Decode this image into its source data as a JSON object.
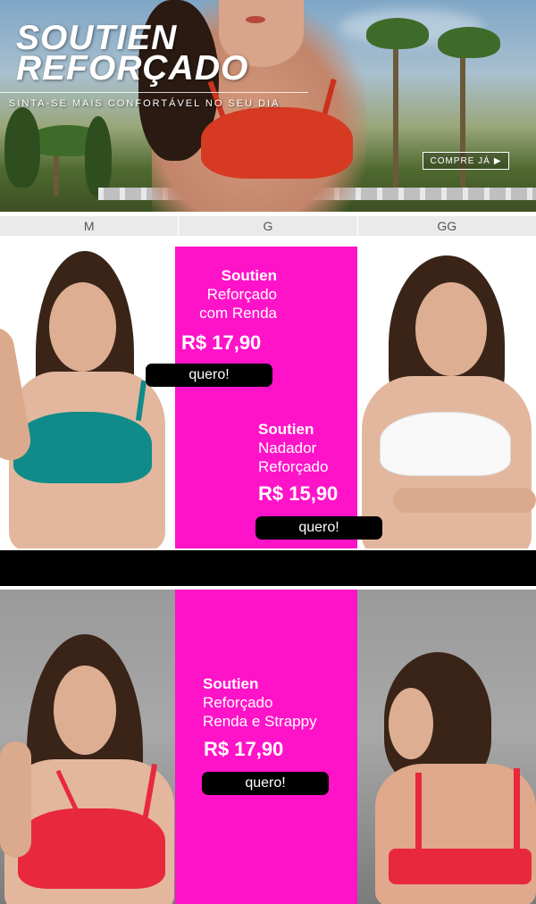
{
  "hero": {
    "title_line1": "SOUTIEN",
    "title_line2": "REFORÇADO",
    "subtitle": "SINTA-SE MAIS CONFORTÁVEL NO SEU DIA",
    "cta_label": "COMPRE JÁ",
    "cta_icon": "play-triangle-icon"
  },
  "sizes": [
    "M",
    "G",
    "GG"
  ],
  "products": [
    {
      "name_bold": "Soutien",
      "name_line2": "Reforçado",
      "name_line3": "com Renda",
      "price": "R$ 17,90",
      "button": "quero!"
    },
    {
      "name_bold": "Soutien",
      "name_line2": "Nadador",
      "name_line3": "Reforçado",
      "price": "R$ 15,90",
      "button": "quero!"
    },
    {
      "name_bold": "Soutien",
      "name_line2": "Reforçado",
      "name_line3": "Renda e Strappy",
      "price": "R$ 17,90",
      "button": "quero!"
    }
  ],
  "colors": {
    "pink_panel": "#ff13c9",
    "button_bg": "#000000",
    "size_bar_bg": "#eaeaea",
    "teal_bra": "#0f8b89",
    "red_bra": "#e8293d",
    "hero_bra": "#d63a22"
  }
}
